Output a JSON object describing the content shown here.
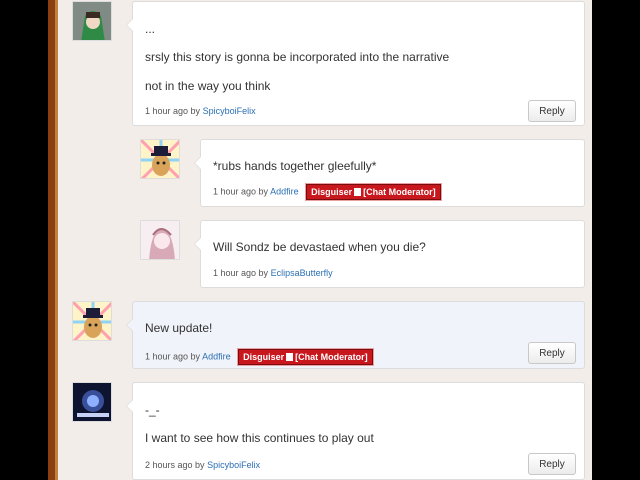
{
  "comments": [
    {
      "lines": [
        "...",
        "srsly this story is gonna be incorporated into the narrative",
        "not in the way you think"
      ],
      "time": "1 hour ago by",
      "author": "SpicyboiFelix",
      "reply": "Reply"
    },
    {
      "lines": [
        "*rubs hands together gleefully*"
      ],
      "time": "1 hour ago by",
      "author": "Addfire",
      "badge": "Disguiser",
      "badge2": "[Chat Moderator]"
    },
    {
      "lines": [
        "Will Sondz be devastaed when you die?"
      ],
      "time": "1 hour ago by",
      "author": "EclipsaButterfly"
    },
    {
      "lines": [
        "New update!"
      ],
      "time": "1 hour ago by",
      "author": "Addfire",
      "badge": "Disguiser",
      "badge2": "[Chat Moderator]",
      "reply": "Reply"
    },
    {
      "lines": [
        "-_-",
        "I want to see how this continues to play out"
      ],
      "time": "2 hours ago by",
      "author": "SpicyboiFelix",
      "reply": "Reply"
    }
  ],
  "colors": {
    "badge": "#c9171e",
    "link": "#2b6fb4",
    "rail": "#8a3f10"
  },
  "avatars": [
    "green-hood-avatar",
    "potato-hat-avatar",
    "sketch-girl-avatar",
    "potato-hat-avatar",
    "dark-art-avatar"
  ]
}
